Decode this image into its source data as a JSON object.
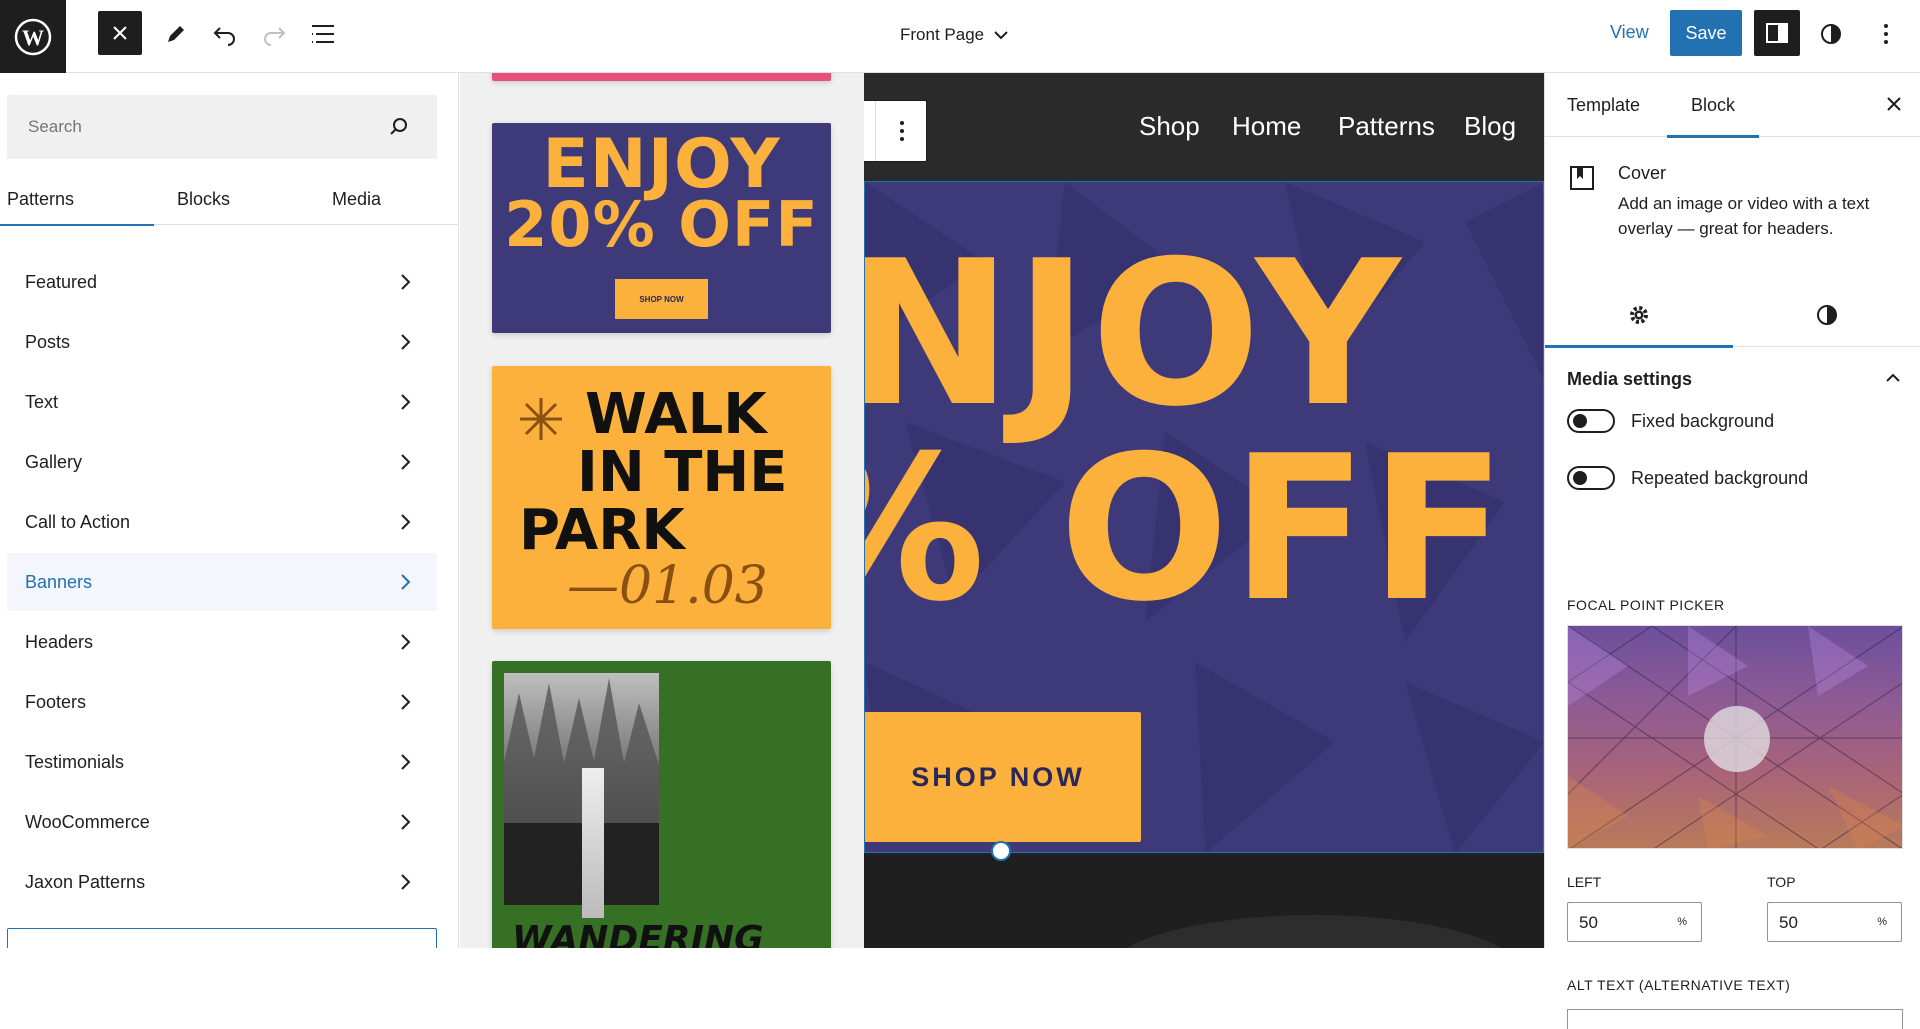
{
  "topbar": {
    "document_title": "Front Page",
    "view_label": "View",
    "save_label": "Save"
  },
  "inserter": {
    "search_placeholder": "Search",
    "tabs": [
      {
        "label": "Patterns",
        "active": true
      },
      {
        "label": "Blocks",
        "active": false
      },
      {
        "label": "Media",
        "active": false
      }
    ],
    "categories": [
      {
        "label": "Featured",
        "active": false
      },
      {
        "label": "Posts",
        "active": false
      },
      {
        "label": "Text",
        "active": false
      },
      {
        "label": "Gallery",
        "active": false
      },
      {
        "label": "Call to Action",
        "active": false
      },
      {
        "label": "Banners",
        "active": true
      },
      {
        "label": "Headers",
        "active": false
      },
      {
        "label": "Footers",
        "active": false
      },
      {
        "label": "Testimonials",
        "active": false
      },
      {
        "label": "WooCommerce",
        "active": false
      },
      {
        "label": "Jaxon Patterns",
        "active": false
      }
    ]
  },
  "patterns": {
    "enjoy": {
      "heading_line1": "ENJOY",
      "heading_line2": "20% OFF",
      "button": "SHOP NOW"
    },
    "walk": {
      "line1": "WALK",
      "line2": "IN THE",
      "line3": "PARK",
      "date": "—01.03"
    },
    "wander": {
      "title": "WANDERING"
    }
  },
  "canvas": {
    "nav": [
      "Shop",
      "Home",
      "Patterns",
      "Blog"
    ],
    "cover_line1": "NJOY",
    "cover_line2": "% OFF",
    "cover_button": "SHOP NOW"
  },
  "sidebar": {
    "tabs": [
      {
        "label": "Template",
        "active": false
      },
      {
        "label": "Block",
        "active": true
      }
    ],
    "block_name": "Cover",
    "block_description": "Add an image or video with a text overlay — great for headers.",
    "media_settings_title": "Media settings",
    "fixed_background_label": "Fixed background",
    "repeated_background_label": "Repeated background",
    "focal_point_label": "FOCAL POINT PICKER",
    "left_label": "LEFT",
    "top_label": "TOP",
    "left_value": "50",
    "top_value": "50",
    "unit": "%",
    "alt_text_label": "ALT TEXT (ALTERNATIVE TEXT)"
  },
  "colors": {
    "accent": "#2271b1",
    "cover_bg": "#3e3a7a",
    "cover_text": "#fbb13c",
    "dark": "#1e1e1e"
  }
}
